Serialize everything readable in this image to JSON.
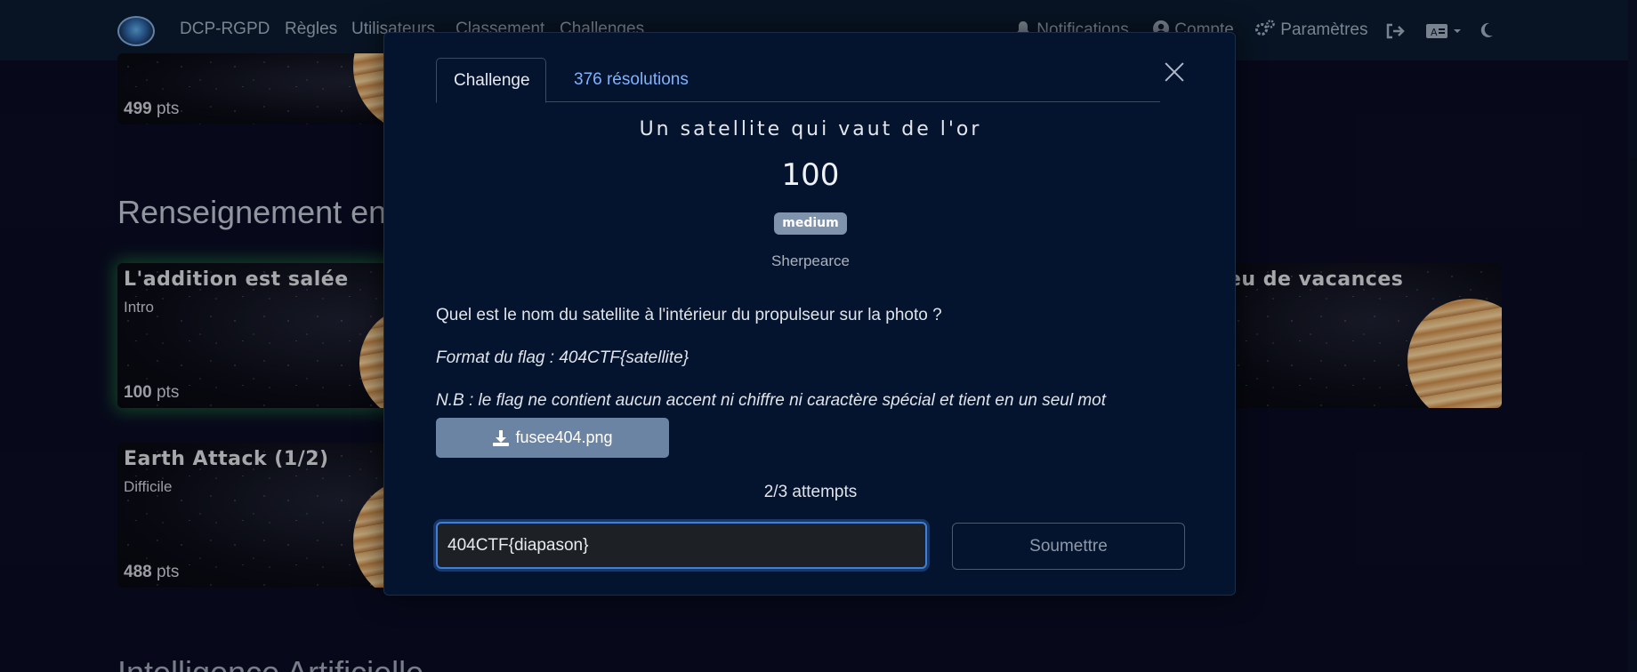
{
  "navbar": {
    "brand": "DCP-RGPD",
    "links": [
      "Règles",
      "Utilisateurs",
      "Classement",
      "Challenges"
    ],
    "right": {
      "notifications": "Notifications",
      "account": "Compte",
      "settings": "Paramètres"
    }
  },
  "background": {
    "top_card_pts": "499",
    "section_title": "Renseignement en",
    "cards": [
      {
        "title": "L'addition est salée",
        "category": "Intro",
        "pts": "100"
      },
      {
        "title": "Earth Attack (1/2)",
        "category": "Difficile",
        "pts": "488"
      },
      {
        "title": "eu de vacances"
      }
    ],
    "pts_unit": "pts",
    "next_section_title": "Intelligence Artificielle"
  },
  "modal": {
    "tabs": [
      "Challenge",
      "376 résolutions"
    ],
    "challenge_name": "Un satellite qui vaut de l'or",
    "value": "100",
    "difficulty": "medium",
    "author": "Sherpearce",
    "description": "Quel est le nom du satellite à l'intérieur du propulseur sur la photo ?",
    "flag_format": "Format du flag : 404CTF{satellite}",
    "note": "N.B : le flag ne contient aucun accent ni chiffre ni caractère spécial et tient en un seul mot",
    "file": "fusee404.png",
    "attempts": "2/3 attempts",
    "input_value": "404CTF{diapason}",
    "submit_label": "Soumettre"
  },
  "colors": {
    "navbar_bg": "#0b1a2e",
    "modal_bg": "#04132e",
    "tab_link": "#7fb3ff",
    "badge_bg": "#8093ad",
    "download_bg": "#6c84a4",
    "input_focus": "#3f7fd8"
  },
  "icons": [
    "logo-icon",
    "bell-icon",
    "user-circle-icon",
    "gears-icon",
    "logout-icon",
    "language-icon",
    "moon-icon",
    "download-icon",
    "close-icon"
  ]
}
